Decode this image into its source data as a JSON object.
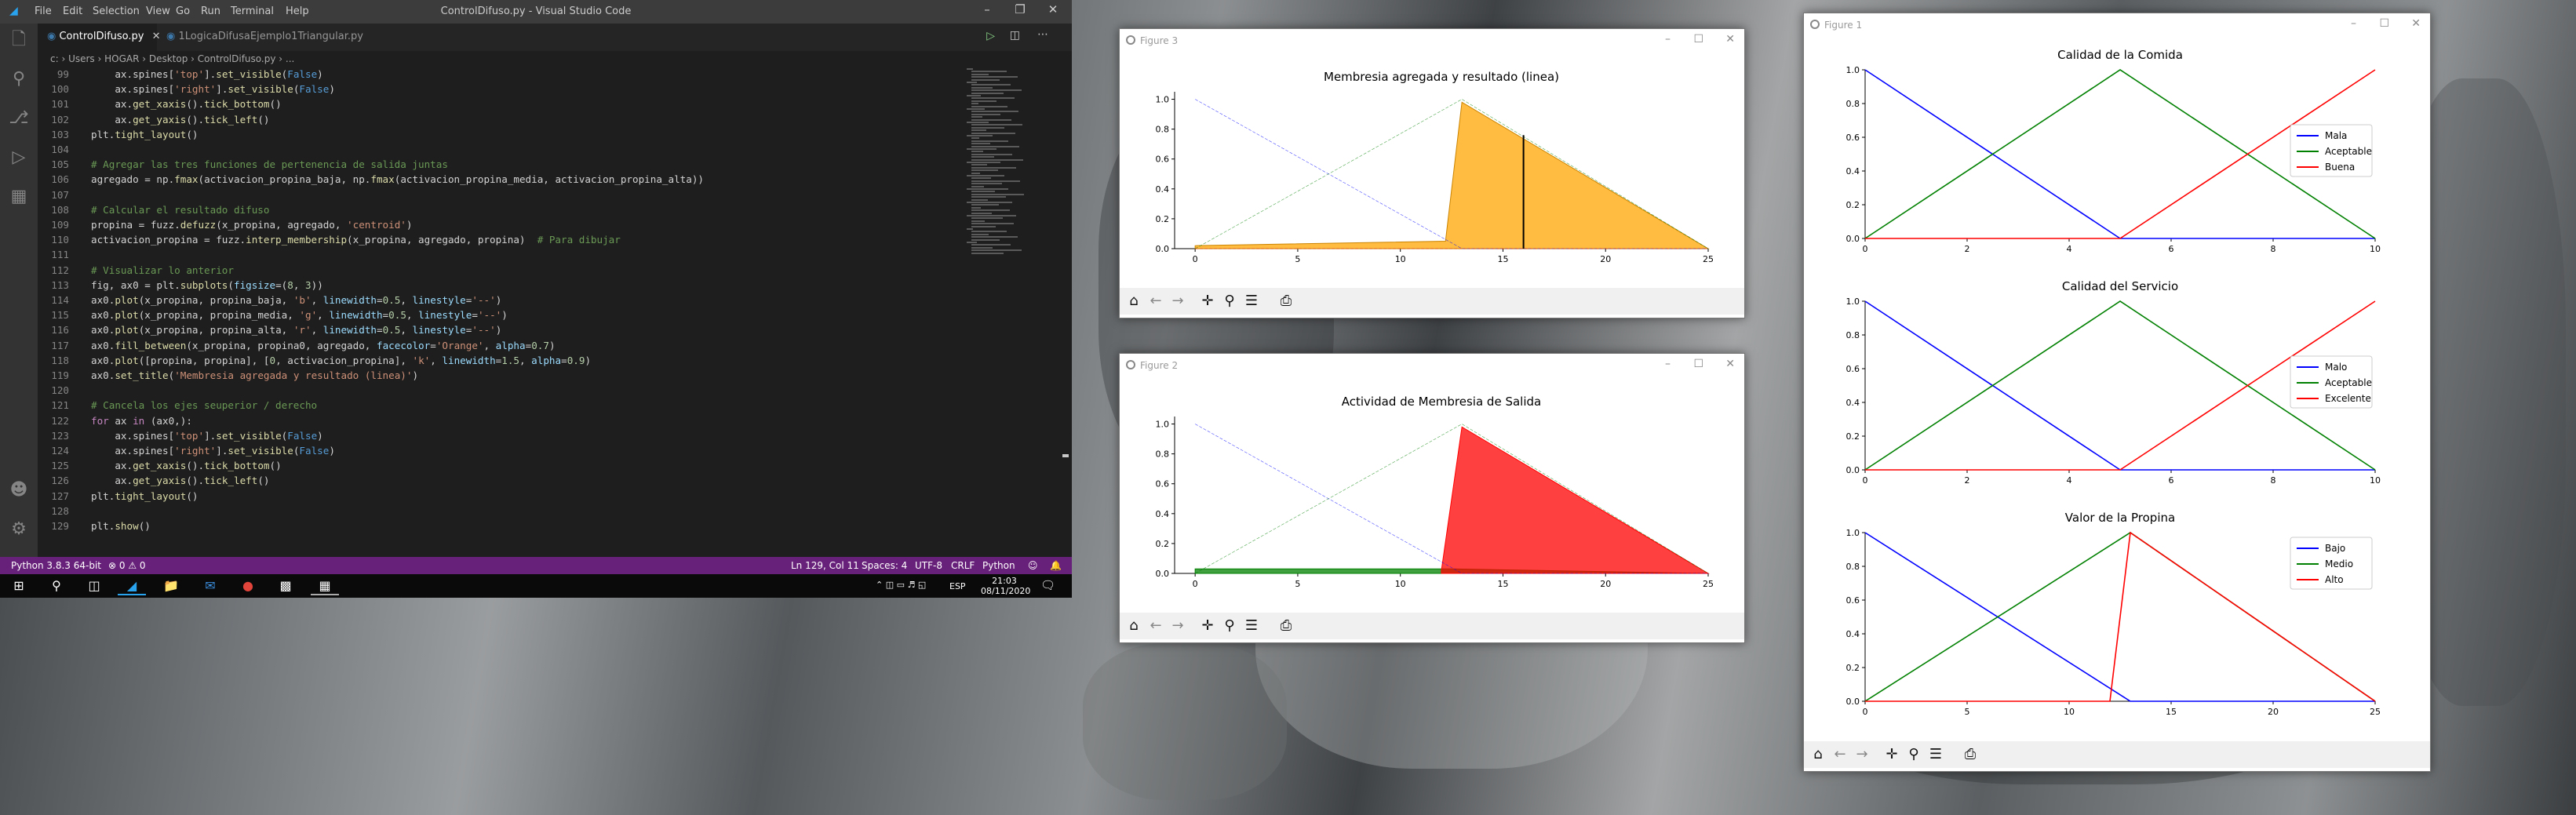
{
  "vscode": {
    "window_title": "ControlDifuso.py - Visual Studio Code",
    "menu": [
      "File",
      "Edit",
      "Selection",
      "View",
      "Go",
      "Run",
      "Terminal",
      "Help"
    ],
    "tabs": [
      {
        "label": "ControlDifuso.py",
        "active": true
      },
      {
        "label": "1LogicaDifusaEjemplo1Triangular.py",
        "active": false
      }
    ],
    "breadcrumb": "c: › Users › HOGAR › Desktop › ControlDifuso.py › ...",
    "code_lines": [
      {
        "n": "99",
        "text": "    ax.spines['top'].set_visible(False)"
      },
      {
        "n": "100",
        "text": "    ax.spines['right'].set_visible(False)"
      },
      {
        "n": "101",
        "text": "    ax.get_xaxis().tick_bottom()"
      },
      {
        "n": "102",
        "text": "    ax.get_yaxis().tick_left()"
      },
      {
        "n": "103",
        "text": "plt.tight_layout()"
      },
      {
        "n": "104",
        "text": ""
      },
      {
        "n": "105",
        "text": "# Agregar las tres funciones de pertenencia de salida juntas"
      },
      {
        "n": "106",
        "text": "agregado = np.fmax(activacion_propina_baja, np.fmax(activacion_propina_media, activacion_propina_alta))"
      },
      {
        "n": "107",
        "text": ""
      },
      {
        "n": "108",
        "text": "# Calcular el resultado difuso"
      },
      {
        "n": "109",
        "text": "propina = fuzz.defuzz(x_propina, agregado, 'centroid')"
      },
      {
        "n": "110",
        "text": "activacion_propina = fuzz.interp_membership(x_propina, agregado, propina)  # Para dibujar"
      },
      {
        "n": "111",
        "text": ""
      },
      {
        "n": "112",
        "text": "# Visualizar lo anterior"
      },
      {
        "n": "113",
        "text": "fig, ax0 = plt.subplots(figsize=(8, 3))"
      },
      {
        "n": "114",
        "text": "ax0.plot(x_propina, propina_baja, 'b', linewidth=0.5, linestyle='--')"
      },
      {
        "n": "115",
        "text": "ax0.plot(x_propina, propina_media, 'g', linewidth=0.5, linestyle='--')"
      },
      {
        "n": "116",
        "text": "ax0.plot(x_propina, propina_alta, 'r', linewidth=0.5, linestyle='--')"
      },
      {
        "n": "117",
        "text": "ax0.fill_between(x_propina, propina0, agregado, facecolor='Orange', alpha=0.7)"
      },
      {
        "n": "118",
        "text": "ax0.plot([propina, propina], [0, activacion_propina], 'k', linewidth=1.5, alpha=0.9)"
      },
      {
        "n": "119",
        "text": "ax0.set_title('Membresia agregada y resultado (linea)')"
      },
      {
        "n": "120",
        "text": ""
      },
      {
        "n": "121",
        "text": "# Cancela los ejes seuperior / derecho"
      },
      {
        "n": "122",
        "text": "for ax in (ax0,):"
      },
      {
        "n": "123",
        "text": "    ax.spines['top'].set_visible(False)"
      },
      {
        "n": "124",
        "text": "    ax.spines['right'].set_visible(False)"
      },
      {
        "n": "125",
        "text": "    ax.get_xaxis().tick_bottom()"
      },
      {
        "n": "126",
        "text": "    ax.get_yaxis().tick_left()"
      },
      {
        "n": "127",
        "text": "plt.tight_layout()"
      },
      {
        "n": "128",
        "text": ""
      },
      {
        "n": "129",
        "text": "plt.show()"
      }
    ],
    "status": {
      "python": "Python 3.8.3 64-bit",
      "problems": "⊗ 0 ⚠ 0",
      "position": "Ln 129, Col 11",
      "spaces": "Spaces: 4",
      "encoding": "UTF-8",
      "eol": "CRLF",
      "language": "Python"
    }
  },
  "taskbar": {
    "lang": "ESP",
    "time": "21:03",
    "date": "08/11/2020"
  },
  "figure3": {
    "window_title": "Figure 3",
    "chart_data": {
      "type": "area",
      "title": "Membresia agregada y resultado (linea)",
      "xlim": [
        -1,
        25
      ],
      "ylim": [
        0,
        1.05
      ],
      "xticks": [
        0,
        5,
        10,
        15,
        20,
        25
      ],
      "yticks": [
        "0.0",
        "0.2",
        "0.4",
        "0.6",
        "0.8",
        "1.0"
      ],
      "series": [
        {
          "name": "",
          "type": "line",
          "color": "#0000ff",
          "x": [
            0,
            13,
            25
          ],
          "y": [
            1,
            0,
            0
          ]
        },
        {
          "name": "",
          "type": "line",
          "color": "#008000",
          "x": [
            0,
            13,
            25
          ],
          "y": [
            0,
            1,
            0
          ]
        },
        {
          "name": "",
          "type": "line",
          "color": "#ff0000",
          "x": [
            0,
            13,
            25
          ],
          "y": [
            0,
            0,
            0
          ]
        }
      ],
      "fill": {
        "color": "#ffa500",
        "x": [
          0,
          12.2,
          13,
          25
        ],
        "y": [
          0.02,
          0.05,
          0.98,
          0
        ]
      },
      "result_line": {
        "x": 16,
        "y": 0.76
      }
    }
  },
  "figure2": {
    "window_title": "Figure 2",
    "chart_data": {
      "type": "area",
      "title": "Actividad de Membresia de Salida",
      "xlim": [
        -1,
        25
      ],
      "ylim": [
        0,
        1.05
      ],
      "xticks": [
        0,
        5,
        10,
        15,
        20,
        25
      ],
      "yticks": [
        "0.0",
        "0.2",
        "0.4",
        "0.6",
        "0.8",
        "1.0"
      ],
      "series": [
        {
          "name": "",
          "type": "line",
          "color": "#0000ff",
          "x": [
            0,
            13,
            25
          ],
          "y": [
            1,
            0,
            0
          ]
        },
        {
          "name": "",
          "type": "line",
          "color": "#008000",
          "x": [
            0,
            13,
            25
          ],
          "y": [
            0,
            1,
            0
          ]
        }
      ],
      "fills": [
        {
          "color": "#008000",
          "x": [
            0,
            12.5,
            25
          ],
          "y": [
            0.03,
            0.03,
            0.0
          ]
        },
        {
          "color": "#ff0000",
          "x": [
            12,
            13,
            25
          ],
          "y": [
            0.02,
            0.98,
            0.0
          ]
        }
      ]
    }
  },
  "figure1": {
    "window_title": "Figure 1",
    "charts": [
      {
        "type": "line",
        "title": "Calidad de la Comida",
        "xlim": [
          0,
          10
        ],
        "ylim": [
          0,
          1
        ],
        "xticks": [
          0,
          2,
          4,
          6,
          8,
          10
        ],
        "yticks": [
          "0.0",
          "0.2",
          "0.4",
          "0.6",
          "0.8",
          "1.0"
        ],
        "series": [
          {
            "name": "Mala",
            "color": "#0000ff",
            "x": [
              0,
              5,
              10
            ],
            "y": [
              1,
              0,
              0
            ]
          },
          {
            "name": "Aceptable",
            "color": "#008000",
            "x": [
              0,
              5,
              10
            ],
            "y": [
              0,
              1,
              0
            ]
          },
          {
            "name": "Buena",
            "color": "#ff0000",
            "x": [
              0,
              5,
              10
            ],
            "y": [
              0,
              0,
              1
            ]
          }
        ],
        "legend": "right"
      },
      {
        "type": "line",
        "title": "Calidad del Servicio",
        "xlim": [
          0,
          10
        ],
        "ylim": [
          0,
          1
        ],
        "xticks": [
          0,
          2,
          4,
          6,
          8,
          10
        ],
        "yticks": [
          "0.0",
          "0.2",
          "0.4",
          "0.6",
          "0.8",
          "1.0"
        ],
        "series": [
          {
            "name": "Malo",
            "color": "#0000ff",
            "x": [
              0,
              5,
              10
            ],
            "y": [
              1,
              0,
              0
            ]
          },
          {
            "name": "Aceptable",
            "color": "#008000",
            "x": [
              0,
              5,
              10
            ],
            "y": [
              0,
              1,
              0
            ]
          },
          {
            "name": "Excelente",
            "color": "#ff0000",
            "x": [
              0,
              5,
              10
            ],
            "y": [
              0,
              0,
              1
            ]
          }
        ],
        "legend": "right"
      },
      {
        "type": "line",
        "title": "Valor de la Propina",
        "xlim": [
          0,
          25
        ],
        "ylim": [
          0,
          1
        ],
        "xticks": [
          0,
          5,
          10,
          15,
          20,
          25
        ],
        "yticks": [
          "0.0",
          "0.2",
          "0.4",
          "0.6",
          "0.8",
          "1.0"
        ],
        "series": [
          {
            "name": "Bajo",
            "color": "#0000ff",
            "x": [
              0,
              13,
              25
            ],
            "y": [
              1,
              0,
              0
            ]
          },
          {
            "name": "Medio",
            "color": "#008000",
            "x": [
              0,
              13,
              25
            ],
            "y": [
              0,
              1,
              0
            ]
          },
          {
            "name": "Alto",
            "color": "#ff0000",
            "x": [
              0,
              12,
              13,
              25
            ],
            "y": [
              0,
              0,
              1,
              0
            ]
          }
        ],
        "legend": "top-right"
      }
    ]
  }
}
